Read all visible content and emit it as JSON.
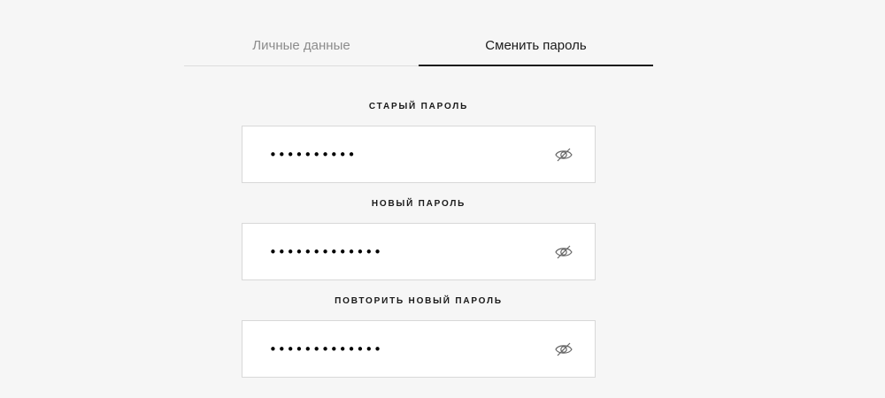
{
  "tabs": [
    {
      "label": "Личные данные",
      "active": false
    },
    {
      "label": "Сменить пароль",
      "active": true
    }
  ],
  "fields": [
    {
      "label": "СТАРЫЙ ПАРОЛЬ",
      "value": "••••••••••",
      "icon": "eye-slash-icon"
    },
    {
      "label": "НОВЫЙ ПАРОЛЬ",
      "value": "•••••••••••••",
      "icon": "eye-slash-icon"
    },
    {
      "label": "ПОВТОРИТЬ НОВЫЙ ПАРОЛЬ",
      "value": "•••••••••••••",
      "icon": "eye-slash-icon"
    }
  ],
  "colors": {
    "background": "#f6f6f6",
    "text": "#1a1a1a",
    "inactive_tab": "#8c8c8c",
    "border": "#d8d8d8"
  }
}
